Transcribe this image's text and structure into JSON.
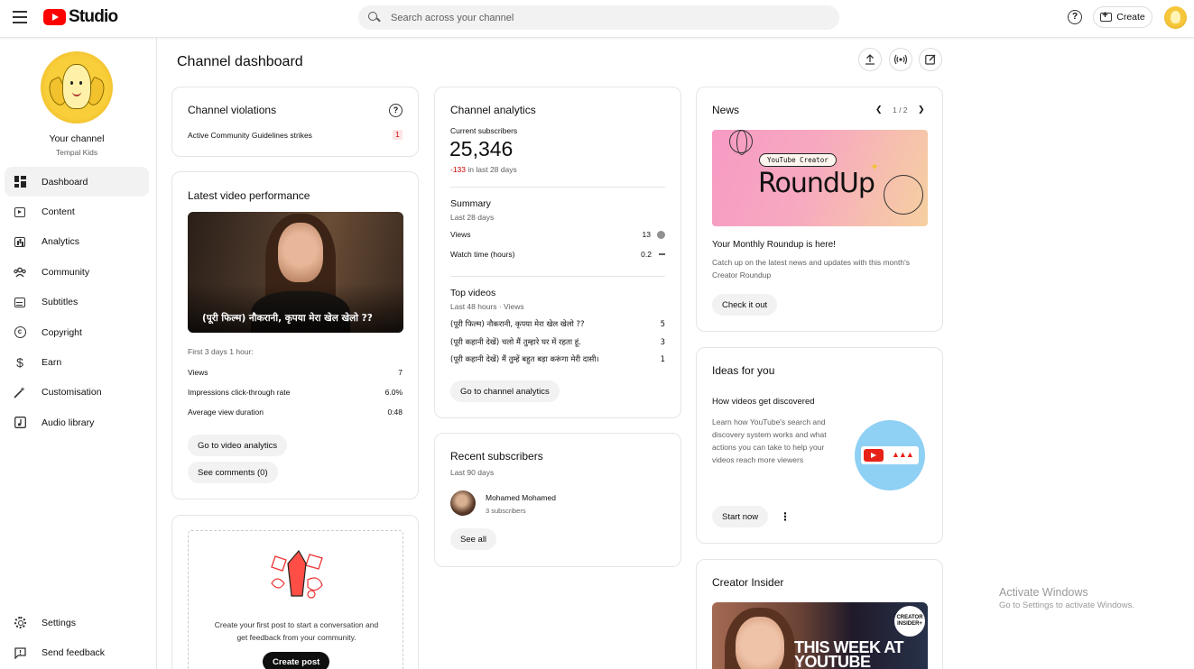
{
  "topbar": {
    "brand": "Studio",
    "search_placeholder": "Search across your channel",
    "help_glyph": "?",
    "create_label": "Create"
  },
  "sidebar": {
    "channel_title": "Your channel",
    "channel_name": "Tempal Kids",
    "items": [
      {
        "label": "Dashboard",
        "icon": "dashboard-icon"
      },
      {
        "label": "Content",
        "icon": "content-icon"
      },
      {
        "label": "Analytics",
        "icon": "analytics-icon"
      },
      {
        "label": "Community",
        "icon": "community-icon"
      },
      {
        "label": "Subtitles",
        "icon": "subtitles-icon"
      },
      {
        "label": "Copyright",
        "icon": "copyright-icon"
      },
      {
        "label": "Earn",
        "icon": "earn-icon"
      },
      {
        "label": "Customisation",
        "icon": "customisation-icon"
      },
      {
        "label": "Audio library",
        "icon": "audio-library-icon"
      }
    ],
    "bottom_items": [
      {
        "label": "Settings",
        "icon": "gear-icon"
      },
      {
        "label": "Send feedback",
        "icon": "feedback-icon"
      }
    ]
  },
  "page": {
    "title": "Channel dashboard"
  },
  "violations": {
    "title": "Channel violations",
    "row_label": "Active Community Guidelines strikes",
    "row_value": "1"
  },
  "latest_video": {
    "title": "Latest video performance",
    "thumb_title": "(पूरी फिल्म) नौकरानी, कृपया मेरा खेल खेलो ??",
    "period": "First 3 days 1 hour:",
    "stats": [
      {
        "label": "Views",
        "value": "7"
      },
      {
        "label": "Impressions click-through rate",
        "value": "6.0%"
      },
      {
        "label": "Average view duration",
        "value": "0:48"
      }
    ],
    "btn_analytics": "Go to video analytics",
    "btn_comments": "See comments (0)"
  },
  "create_post": {
    "text_line1": "Create your first post to start a conversation and",
    "text_line2": "get feedback from your community.",
    "button": "Create post"
  },
  "analytics": {
    "title": "Channel analytics",
    "subs_label": "Current subscribers",
    "subs_value": "25,346",
    "subs_change": "-133",
    "subs_change_suffix": "in last 28 days",
    "summary_title": "Summary",
    "summary_period": "Last 28 days",
    "summary_rows": [
      {
        "label": "Views",
        "value": "13"
      },
      {
        "label": "Watch time (hours)",
        "value": "0.2"
      }
    ],
    "top_title": "Top videos",
    "top_period": "Last 48 hours · Views",
    "top_videos": [
      {
        "title": "(पूरी फिल्म) नौकरानी, कृपया मेरा खेल खेलो ??",
        "views": "5"
      },
      {
        "title": "(पूरी कहानी देखें) चलो मैं तुम्हारे घर में रहता हूं.",
        "views": "3"
      },
      {
        "title": "(पूरी कहानी देखें) मैं तुम्हें बहुत बड़ा करूंगा मेरी दासी।",
        "views": "1"
      }
    ],
    "button": "Go to channel analytics"
  },
  "recent_subs": {
    "title": "Recent subscribers",
    "period": "Last 90 days",
    "name": "Mohamed Mohamed",
    "count": "3 subscribers",
    "button": "See all"
  },
  "news": {
    "title": "News",
    "pager": "1 / 2",
    "chip": "YouTube Creator",
    "banner": "RoundUp",
    "headline": "Your Monthly Roundup is here!",
    "body": "Catch up on the latest news and updates with this month's Creator Roundup",
    "button": "Check it out"
  },
  "ideas": {
    "title": "Ideas for you",
    "subtitle": "How videos get discovered",
    "body": "Learn how YouTube's search and discovery system works and what actions you can take to help your videos reach more viewers",
    "button": "Start now"
  },
  "creator_insider": {
    "title": "Creator Insider",
    "logo_line1": "CREATOR",
    "logo_line2": "INSIDER+",
    "banner_line1": "THIS WEEK AT",
    "banner_line2": "YOUTUBE"
  },
  "watermark": {
    "line1": "Activate Windows",
    "line2": "Go to Settings to activate Windows."
  }
}
